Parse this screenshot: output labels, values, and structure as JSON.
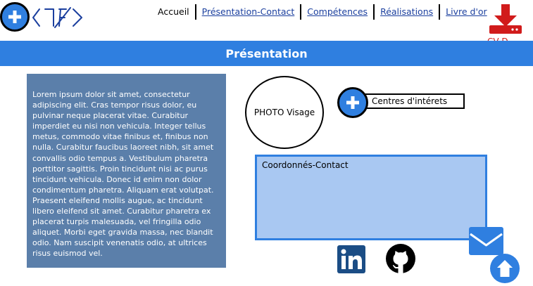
{
  "header": {
    "nav": [
      {
        "label": "Accueil",
        "link": false
      },
      {
        "label": "Présentation-Contact",
        "link": true
      },
      {
        "label": "Compétences",
        "link": true
      },
      {
        "label": "Réalisations",
        "link": true
      },
      {
        "label": "Livre d'or",
        "link": true
      }
    ],
    "cv_label": "CV D...",
    "icons": {
      "menu": "plus-icon",
      "logo": "tf-logo",
      "cv": "download-icon"
    }
  },
  "banner": {
    "title": "Présentation"
  },
  "lorem": {
    "text": "Lorem ipsum dolor sit amet, consectetur adipiscing elit. Cras tempor risus dolor, eu pulvinar neque placerat vitae. Curabitur imperdiet eu nisi non vehicula. Integer tellus metus, commodo vitae finibus et, finibus non nulla. Curabitur faucibus laoreet nibh, sit amet convallis odio tempus a. Vestibulum pharetra porttitor sagittis. Proin tincidunt nisi ac purus tincidunt vehicula. Donec id enim non dolor condimentum pharetra. Aliquam erat volutpat. Praesent eleifend mollis augue, ac tincidunt libero eleifend sit amet. Curabitur pharetra ex placerat turpis malesuada, vel fringilla odio aliquet. Morbi eget gravida massa, nec blandit odio. Nam suscipit venenatis odio, at ultrices risus euismod vel."
  },
  "photo": {
    "label": "PHOTO Visage"
  },
  "interests": {
    "label": "Centres d'intérets"
  },
  "contact": {
    "title": "Coordonnés-Contact"
  },
  "social": {
    "linkedin": "linkedin-icon",
    "github": "github-icon"
  },
  "colors": {
    "accent": "#2f7fe0",
    "lorem_bg": "#5b7faa",
    "contact_bg": "#a9c8f2",
    "download_red": "#d11b1b",
    "linkedin_blue": "#1b4d85"
  }
}
